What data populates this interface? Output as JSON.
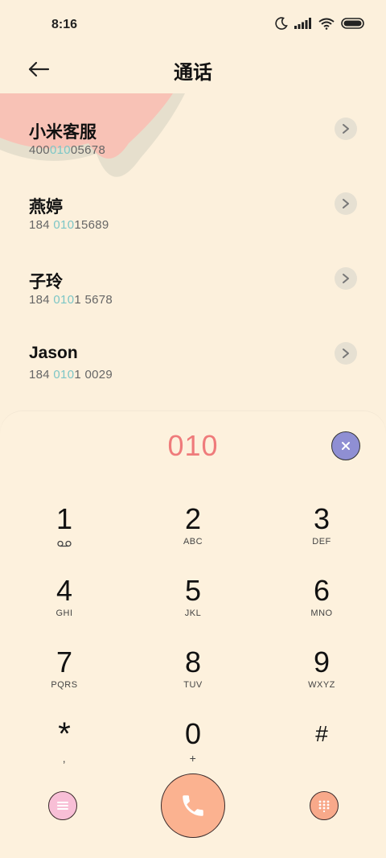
{
  "status_bar": {
    "time": "8:16",
    "icons": [
      "moon-icon",
      "signal-icon",
      "wifi-icon",
      "battery-icon"
    ]
  },
  "header": {
    "title": "通话",
    "back_icon": "back-arrow-icon"
  },
  "contacts": [
    {
      "name": "小米客服",
      "number_pre": "400",
      "number_match": "010",
      "number_post": "05678"
    },
    {
      "name": "燕婷",
      "number_pre": "184 ",
      "number_match": "010",
      "number_post": "15689"
    },
    {
      "name": "子玲",
      "number_pre": "184 ",
      "number_match": "010",
      "number_post": "1 5678"
    },
    {
      "name": "Jason",
      "number_pre": "184 ",
      "number_match": "010",
      "number_post": "1 0029"
    }
  ],
  "dialer": {
    "dialed": "010",
    "keys": [
      {
        "digit": "1",
        "letters": ""
      },
      {
        "digit": "2",
        "letters": "ABC"
      },
      {
        "digit": "3",
        "letters": "DEF"
      },
      {
        "digit": "4",
        "letters": "GHI"
      },
      {
        "digit": "5",
        "letters": "JKL"
      },
      {
        "digit": "6",
        "letters": "MNO"
      },
      {
        "digit": "7",
        "letters": "PQRS"
      },
      {
        "digit": "8",
        "letters": "TUV"
      },
      {
        "digit": "9",
        "letters": "WXYZ"
      },
      {
        "digit": "*",
        "letters": ","
      },
      {
        "digit": "0",
        "letters": "+"
      },
      {
        "digit": "#",
        "letters": ""
      }
    ]
  },
  "colors": {
    "background": "#fcf0dc",
    "dialed_number": "#ef7b7b",
    "match_highlight": "#7cc6c6",
    "clear_button": "#8f8fd3",
    "call_button": "#fbb290",
    "menu_button": "#f8bfd6",
    "keypad_button": "#f8a98a"
  }
}
